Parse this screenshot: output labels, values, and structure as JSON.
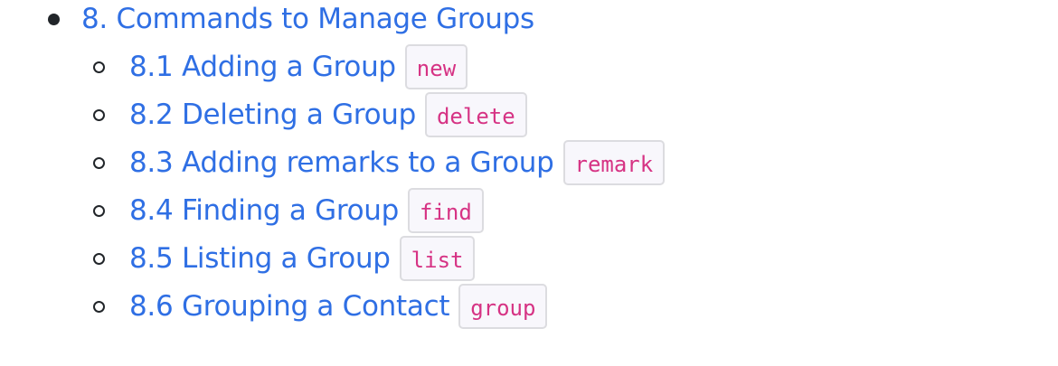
{
  "toc": {
    "section": {
      "label": "8. Commands to Manage Groups"
    },
    "items": [
      {
        "label": "8.1 Adding a Group",
        "command": "new"
      },
      {
        "label": "8.2 Deleting a Group",
        "command": "delete"
      },
      {
        "label": "8.3 Adding remarks to a Group",
        "command": "remark"
      },
      {
        "label": "8.4 Finding a Group",
        "command": "find"
      },
      {
        "label": "8.5 Listing a Group",
        "command": "list"
      },
      {
        "label": "8.6 Grouping a Contact",
        "command": "group"
      }
    ]
  },
  "colors": {
    "link": "#2f6fe4",
    "code_text": "#d63384",
    "code_background": "#f8f7fc",
    "code_border": "#dcdce0",
    "bullet": "#212529"
  }
}
